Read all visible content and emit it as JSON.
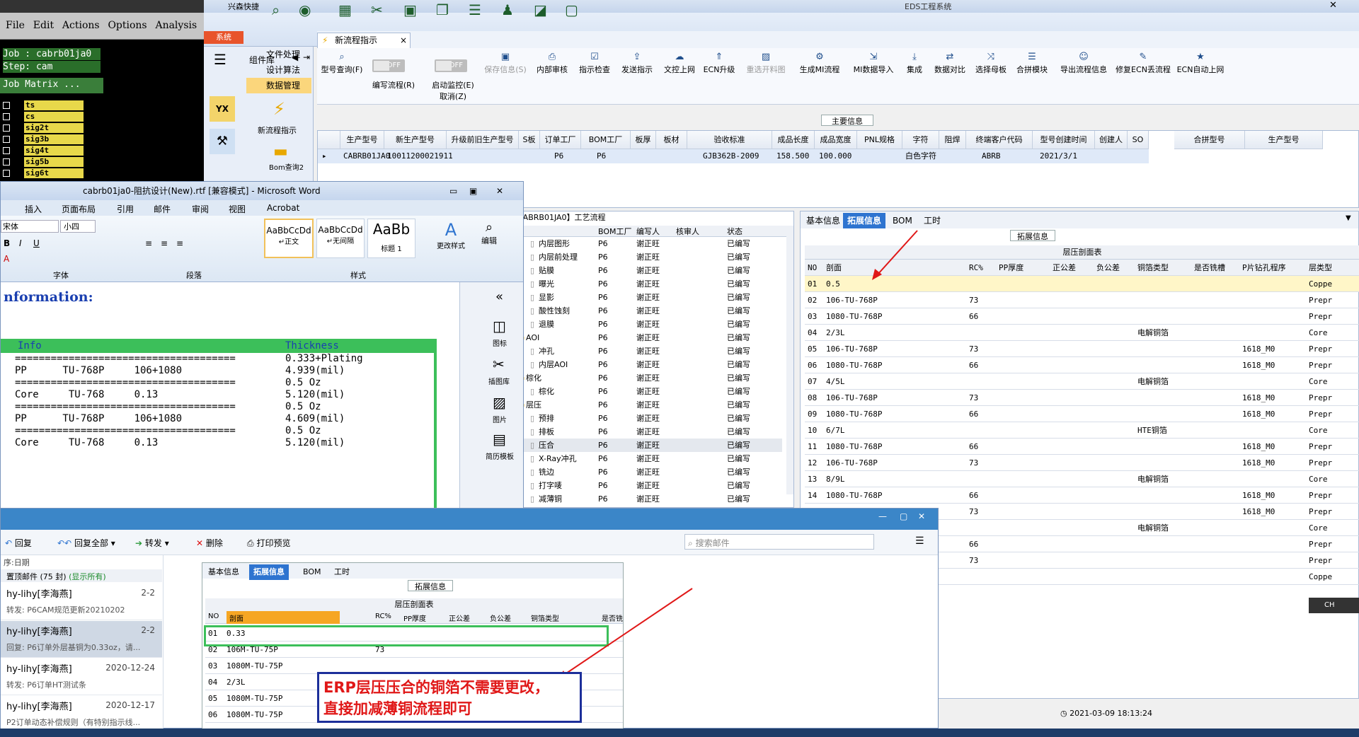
{
  "genesis": {
    "menu": [
      "File",
      "Edit",
      "Actions",
      "Options",
      "Analysis"
    ],
    "job_line": "Job : cabrb01ja0",
    "step_line": "Step: cam",
    "matrix_btn": "Job Matrix ...",
    "layers": [
      "ts",
      "cs",
      "sig2t",
      "sig3b",
      "sig4t",
      "sig5b",
      "sig6t"
    ]
  },
  "eds": {
    "app_title": "兴森快捷",
    "window_title": "EDS工程系统",
    "system_tab": "系统",
    "component_lib": "组件库",
    "nav": [
      "文件处理",
      "设计算法",
      "数据管理"
    ],
    "left_icons": [
      "新流程指示",
      "Bom查询2"
    ],
    "tab_new": "新流程指示",
    "ribbon": [
      {
        "label": "型号查询(F)",
        "icon": "search-icon",
        "enabled": true
      },
      {
        "label": "编写流程(R)",
        "icon": "toggle",
        "enabled": true
      },
      {
        "label": "启动监控(E)",
        "icon": "toggle",
        "enabled": true
      },
      {
        "label": "保存信息(S)",
        "icon": "save-icon",
        "enabled": false
      },
      {
        "label": "内部审核",
        "icon": "print-icon",
        "enabled": true
      },
      {
        "label": "指示检查",
        "icon": "check-icon",
        "enabled": true
      },
      {
        "label": "发送指示",
        "icon": "upload-icon",
        "enabled": true
      },
      {
        "label": "文控上网",
        "icon": "cloud-icon",
        "enabled": true
      },
      {
        "label": "ECN升级",
        "icon": "arrow-icon",
        "enabled": true
      },
      {
        "label": "重选开料图",
        "icon": "image-icon",
        "enabled": false
      },
      {
        "label": "生成MI流程",
        "icon": "gear-icon",
        "enabled": true
      },
      {
        "label": "MI数据导入",
        "icon": "import-icon",
        "enabled": true
      },
      {
        "label": "集成",
        "icon": "download-icon",
        "enabled": true
      },
      {
        "label": "数据对比",
        "icon": "compare-icon",
        "enabled": true
      },
      {
        "label": "选择母板",
        "icon": "shuffle-icon",
        "enabled": true
      },
      {
        "label": "合拼模块",
        "icon": "list-icon",
        "enabled": true
      },
      {
        "label": "导出流程信息",
        "icon": "smile-icon",
        "enabled": true
      },
      {
        "label": "修复ECN丢流程",
        "icon": "wrench-icon",
        "enabled": true
      },
      {
        "label": "ECN自动上网",
        "icon": "star-icon",
        "enabled": true
      }
    ],
    "toggle_off": "OFF",
    "cancel_label": "取消(Z)",
    "main_section_title": "主要信息",
    "main_headers": [
      "生产型号",
      "新生产型号",
      "升级前旧生产型号",
      "S板",
      "订单工厂",
      "BOM工厂",
      "板厚",
      "板材",
      "验收标准",
      "成品长度",
      "成品宽度",
      "PNL规格",
      "字符",
      "阻焊",
      "终端客户代码",
      "型号创建时间",
      "创建人",
      "SO"
    ],
    "main_row": [
      "CABRB01JA0",
      "10011200021911",
      "",
      "",
      "P6",
      "P6",
      "",
      "",
      "GJB362B-2009",
      "158.500",
      "100.000",
      "",
      "白色字符",
      "",
      "ABRB",
      "2021/3/1",
      "",
      ""
    ],
    "merge_headers": [
      "合拼型号",
      "生产型号"
    ],
    "process_title": "CABRB01JA0】工艺流程",
    "process_headers": [
      "BOM工厂",
      "编写人",
      "核审人",
      "状态"
    ],
    "process_rows": [
      {
        "name": "内层图形",
        "factory": "P6",
        "writer": "谢正旺",
        "status": "已编写"
      },
      {
        "name": "内层前处理",
        "factory": "P6",
        "writer": "谢正旺",
        "status": "已编写"
      },
      {
        "name": "贴膜",
        "factory": "P6",
        "writer": "谢正旺",
        "status": "已编写"
      },
      {
        "name": "曝光",
        "factory": "P6",
        "writer": "谢正旺",
        "status": "已编写"
      },
      {
        "name": "显影",
        "factory": "P6",
        "writer": "谢正旺",
        "status": "已编写"
      },
      {
        "name": "酸性蚀刻",
        "factory": "P6",
        "writer": "谢正旺",
        "status": "已编写"
      },
      {
        "name": "退膜",
        "factory": "P6",
        "writer": "谢正旺",
        "status": "已编写"
      },
      {
        "name": "AOI",
        "factory": "P6",
        "writer": "谢正旺",
        "status": "已编写"
      },
      {
        "name": "冲孔",
        "factory": "P6",
        "writer": "谢正旺",
        "status": "已编写"
      },
      {
        "name": "内层AOI",
        "factory": "P6",
        "writer": "谢正旺",
        "status": "已编写"
      },
      {
        "name": "棕化",
        "factory": "P6",
        "writer": "谢正旺",
        "status": "已编写"
      },
      {
        "name": "棕化",
        "factory": "P6",
        "writer": "谢正旺",
        "status": "已编写"
      },
      {
        "name": "层压",
        "factory": "P6",
        "writer": "谢正旺",
        "status": "已编写"
      },
      {
        "name": "预排",
        "factory": "P6",
        "writer": "谢正旺",
        "status": "已编写"
      },
      {
        "name": "排板",
        "factory": "P6",
        "writer": "谢正旺",
        "status": "已编写"
      },
      {
        "name": "压合",
        "factory": "P6",
        "writer": "谢正旺",
        "status": "已编写"
      },
      {
        "name": "X-Ray冲孔",
        "factory": "P6",
        "writer": "谢正旺",
        "status": "已编写"
      },
      {
        "name": "铣边",
        "factory": "P6",
        "writer": "谢正旺",
        "status": "已编写"
      },
      {
        "name": "打字唛",
        "factory": "P6",
        "writer": "谢正旺",
        "status": "已编写"
      },
      {
        "name": "减薄铜",
        "factory": "P6",
        "writer": "谢正旺",
        "status": "已编写"
      }
    ],
    "right_tabs": [
      "基本信息",
      "拓展信息",
      "BOM",
      "工时"
    ],
    "ext_title": "拓展信息",
    "stack_title": "层压剖面表",
    "stack_headers": [
      "NO",
      "剖面",
      "RC%",
      "PP厚度",
      "正公差",
      "负公差",
      "铜箔类型",
      "是否铣槽",
      "P片钻孔程序",
      "层类型"
    ],
    "stack_rows": [
      [
        "01",
        "0.5",
        "",
        "",
        "",
        "",
        "",
        "",
        "",
        "Coppe"
      ],
      [
        "02",
        "106-TU-768P",
        "73",
        "",
        "",
        "",
        "",
        "",
        "",
        "Prepr"
      ],
      [
        "03",
        "1080-TU-768P",
        "66",
        "",
        "",
        "",
        "",
        "",
        "",
        "Prepr"
      ],
      [
        "04",
        "2/3L",
        "",
        "",
        "",
        "",
        "电解铜箔",
        "",
        "",
        "Core"
      ],
      [
        "05",
        "106-TU-768P",
        "73",
        "",
        "",
        "",
        "",
        "",
        "1618_M0",
        "Prepr"
      ],
      [
        "06",
        "1080-TU-768P",
        "66",
        "",
        "",
        "",
        "",
        "",
        "1618_M0",
        "Prepr"
      ],
      [
        "07",
        "4/5L",
        "",
        "",
        "",
        "",
        "电解铜箔",
        "",
        "",
        "Core"
      ],
      [
        "08",
        "106-TU-768P",
        "73",
        "",
        "",
        "",
        "",
        "",
        "1618_M0",
        "Prepr"
      ],
      [
        "09",
        "1080-TU-768P",
        "66",
        "",
        "",
        "",
        "",
        "",
        "1618_M0",
        "Prepr"
      ],
      [
        "10",
        "6/7L",
        "",
        "",
        "",
        "",
        "HTE铜箔",
        "",
        "",
        "Core"
      ],
      [
        "11",
        "1080-TU-768P",
        "66",
        "",
        "",
        "",
        "",
        "",
        "1618_M0",
        "Prepr"
      ],
      [
        "12",
        "106-TU-768P",
        "73",
        "",
        "",
        "",
        "",
        "",
        "1618_M0",
        "Prepr"
      ],
      [
        "13",
        "8/9L",
        "",
        "",
        "",
        "",
        "电解铜箔",
        "",
        "",
        "Core"
      ],
      [
        "14",
        "1080-TU-768P",
        "66",
        "",
        "",
        "",
        "",
        "",
        "1618_M0",
        "Prepr"
      ],
      [
        "15",
        "",
        "73",
        "",
        "",
        "",
        "",
        "",
        "1618_M0",
        "Prepr"
      ],
      [
        "16",
        "",
        "",
        "",
        "",
        "",
        "电解铜箔",
        "",
        "",
        "Core"
      ],
      [
        "17",
        "",
        "66",
        "",
        "",
        "",
        "",
        "",
        "",
        "Prepr"
      ],
      [
        "18",
        "",
        "73",
        "",
        "",
        "",
        "",
        "",
        "",
        "Prepr"
      ],
      [
        "19",
        "",
        "",
        "",
        "",
        "",
        "",
        "",
        "",
        "Coppe"
      ]
    ],
    "datetime": "2021-03-09 18:13:24"
  },
  "word": {
    "title": "cabrb01ja0-阻抗设计(New).rtf [兼容模式] - Microsoft Word",
    "menu": [
      "插入",
      "页面布局",
      "引用",
      "邮件",
      "审阅",
      "视图",
      "Acrobat"
    ],
    "font_name": "宋体",
    "font_size": "小四",
    "styles": [
      {
        "preview": "AaBbCcDd",
        "name": "↵正文"
      },
      {
        "preview": "AaBbCcDd",
        "name": "↵无间隔"
      },
      {
        "preview": "AaBb",
        "name": "标题 1"
      }
    ],
    "change_style": "更改样式",
    "edit": "编辑",
    "groups": [
      "字体",
      "段落",
      "样式"
    ],
    "side_items": [
      "图标",
      "插图库",
      "图片",
      "简历模板"
    ],
    "heading": "nformation:",
    "col_info": "Info",
    "col_thick": "Thickness",
    "lines": [
      {
        "left": "=====================================",
        "right": "0.333+Plating"
      },
      {
        "left": "PP      TU-768P     106+1080",
        "right": "4.939(mil)"
      },
      {
        "left": "=====================================",
        "right": "0.5 Oz"
      },
      {
        "left": "Core     TU-768     0.13",
        "right": "5.120(mil)"
      },
      {
        "left": "=====================================",
        "right": "0.5 Oz"
      },
      {
        "left": "PP      TU-768P     106+1080",
        "right": "4.609(mil)"
      },
      {
        "left": "=====================================",
        "right": "0.5 Oz"
      },
      {
        "left": "Core     TU-768     0.13",
        "right": "5.120(mil)"
      }
    ]
  },
  "mail": {
    "toolbar": [
      "回复",
      "回复全部",
      "转发",
      "删除",
      "打印预览"
    ],
    "search_placeholder": "搜索邮件",
    "sort": "序:日期",
    "pinned": "置顶邮件 (75 封)",
    "show_all": "(显示所有)",
    "items": [
      {
        "from": "hy-lihy[李海燕]",
        "date": "2-2",
        "subject": "转发: P6CAM规范更新20210202",
        "selected": false
      },
      {
        "from": "hy-lihy[李海燕]",
        "date": "2-2",
        "subject": "回复: P6订单外层基铜为0.33oz，请...",
        "selected": true
      },
      {
        "from": "hy-lihy[李海燕]",
        "date": "2020-12-24",
        "subject": "转发: P6订单HT测试条",
        "selected": false
      },
      {
        "from": "hy-lihy[李海燕]",
        "date": "2020-12-17",
        "subject": "P2订单动态补偿规则（有特别指示线...",
        "selected": false
      }
    ],
    "preview_tabs": [
      "基本信息",
      "拓展信息",
      "BOM",
      "工时"
    ],
    "preview_ext": "拓展信息",
    "preview_stack": "层压剖面表",
    "preview_headers": [
      "NO",
      "剖面",
      "RC%",
      "PP厚度",
      "正公差",
      "负公差",
      "铜箔类型",
      "是否铣"
    ],
    "preview_rows": [
      [
        "01",
        "0.33",
        ""
      ],
      [
        "02",
        "106M-TU-75P",
        "73"
      ],
      [
        "03",
        "1080M-TU-75P",
        ""
      ],
      [
        "04",
        "2/3L",
        ""
      ],
      [
        "05",
        "1080M-TU-75P",
        ""
      ],
      [
        "06",
        "1080M-TU-75P",
        ""
      ]
    ]
  },
  "callout": {
    "line1": "ERP层压压合的铜箔不需要更改，",
    "line2": "直接加减薄铜流程即可"
  },
  "ime": "CH"
}
